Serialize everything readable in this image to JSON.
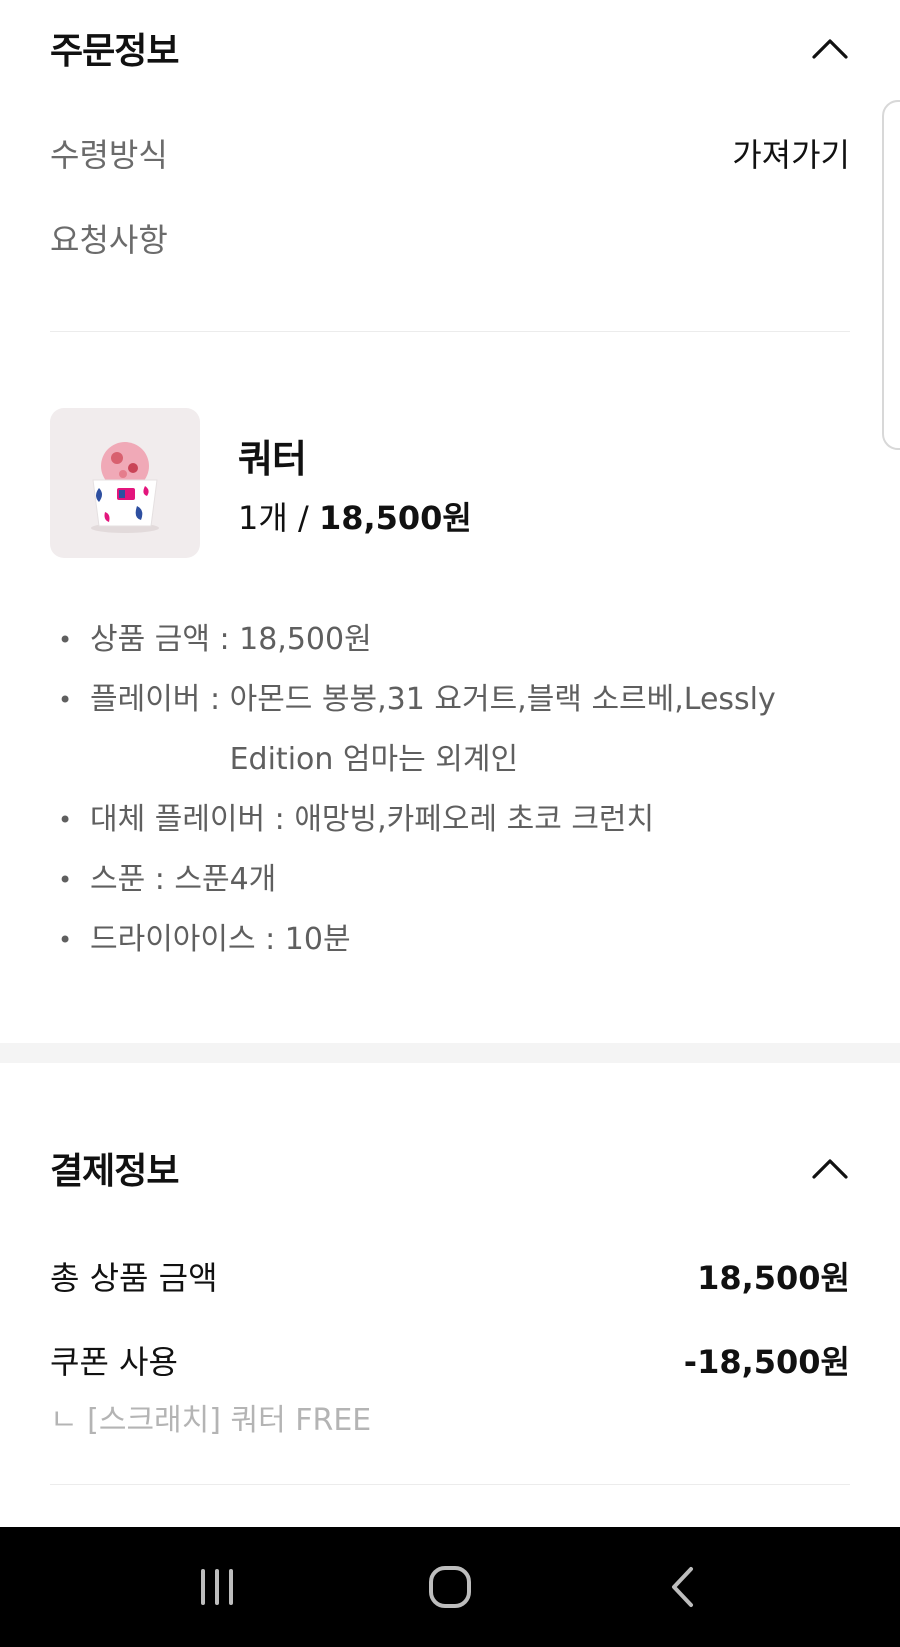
{
  "order_info": {
    "title": "주문정보",
    "pickup_label": "수령방식",
    "pickup_value": "가져가기",
    "request_label": "요청사항"
  },
  "product": {
    "name": "쿼터",
    "qty_prefix": "1개 / ",
    "price": "18,500원",
    "options": [
      {
        "label": "상품 금액",
        "value": "18,500원"
      },
      {
        "label": "플레이버",
        "value": "아몬드 봉봉,31 요거트,블랙 소르베,Lessly Edition 엄마는 외계인"
      },
      {
        "label": "대체 플레이버",
        "value": "애망빙,카페오레 초코 크런치"
      },
      {
        "label": "스푼",
        "value": "스푼4개"
      },
      {
        "label": "드라이아이스",
        "value": "10분"
      }
    ]
  },
  "payment_info": {
    "title": "결제정보",
    "total_label": "총 상품 금액",
    "total_value": "18,500원",
    "coupon_label": "쿠폰 사용",
    "coupon_value": "-18,500원",
    "coupon_detail": "ㄴ [스크래치] 쿼터 FREE"
  },
  "icons": {
    "section_toggle": "chevron-up-icon",
    "nav_recents": "recent-apps-icon",
    "nav_home": "home-icon",
    "nav_back": "back-icon"
  },
  "colors": {
    "text_primary": "#111111",
    "text_secondary": "#6b6b6b",
    "text_muted": "#b4b4b4",
    "thumb_bg": "#f1eced",
    "navbar_bg": "#000000"
  }
}
